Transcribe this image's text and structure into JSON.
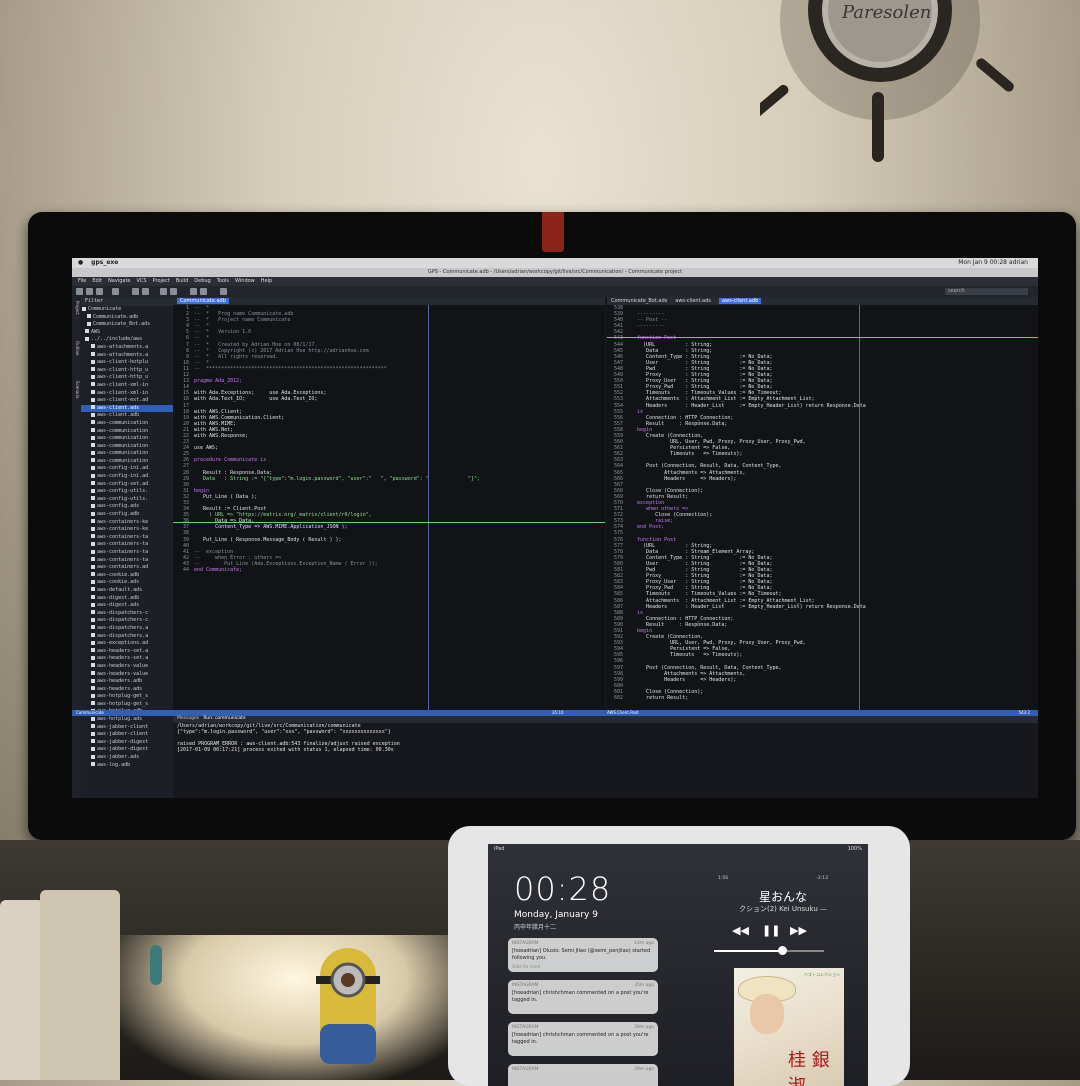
{
  "wall_clock": {
    "brand": "Paresolen"
  },
  "mac_menubar": {
    "app_name": "gps_exe",
    "status_right": "Mon Jan 9  00:28  adrian"
  },
  "window": {
    "title": "GPS - Communicate.adb - /Users/adrian/workcopy/git/live/src/Communication/ - Communicate project"
  },
  "menu": [
    "File",
    "Edit",
    "Navigate",
    "VCS",
    "Project",
    "Build",
    "Debug",
    "Tools",
    "Window",
    "Help"
  ],
  "search": {
    "placeholder": "search"
  },
  "side_tabs": [
    "Project",
    "Outline",
    "Scenario"
  ],
  "project_tree": {
    "filter_placeholder": "Filter",
    "items": [
      {
        "label": "Communicate",
        "sel": false
      },
      {
        "label": "Communicate.adb",
        "sel": false
      },
      {
        "label": "Communicate_Bot.ads",
        "sel": false
      },
      {
        "label": "AWS",
        "sel": false
      },
      {
        "label": "../../include/aws",
        "sel": false
      },
      {
        "label": "aws-attachments.a",
        "sel": false
      },
      {
        "label": "aws-attachments.a",
        "sel": false
      },
      {
        "label": "aws-client-hotplu",
        "sel": false
      },
      {
        "label": "aws-client-http_u",
        "sel": false
      },
      {
        "label": "aws-client-http_u",
        "sel": false
      },
      {
        "label": "aws-client-xml-in",
        "sel": false
      },
      {
        "label": "aws-client-xml-in",
        "sel": false
      },
      {
        "label": "aws-client-ext.ad",
        "sel": false
      },
      {
        "label": "aws-client.ads",
        "sel": true
      },
      {
        "label": "aws-client.adb",
        "sel": false
      },
      {
        "label": "aws-communication",
        "sel": false
      },
      {
        "label": "aws-communication",
        "sel": false
      },
      {
        "label": "aws-communication",
        "sel": false
      },
      {
        "label": "aws-communication",
        "sel": false
      },
      {
        "label": "aws-communication",
        "sel": false
      },
      {
        "label": "aws-communication",
        "sel": false
      },
      {
        "label": "aws-config-ini.ad",
        "sel": false
      },
      {
        "label": "aws-config-ini.ad",
        "sel": false
      },
      {
        "label": "aws-config-set.ad",
        "sel": false
      },
      {
        "label": "aws-config-utils.",
        "sel": false
      },
      {
        "label": "aws-config-utils.",
        "sel": false
      },
      {
        "label": "aws-config.ads",
        "sel": false
      },
      {
        "label": "aws-config.adb",
        "sel": false
      },
      {
        "label": "aws-containers-ke",
        "sel": false
      },
      {
        "label": "aws-containers-ke",
        "sel": false
      },
      {
        "label": "aws-containers-ta",
        "sel": false
      },
      {
        "label": "aws-containers-ta",
        "sel": false
      },
      {
        "label": "aws-containers-ta",
        "sel": false
      },
      {
        "label": "aws-containers-ta",
        "sel": false
      },
      {
        "label": "aws-containers.ad",
        "sel": false
      },
      {
        "label": "aws-cookie.adb",
        "sel": false
      },
      {
        "label": "aws-cookie.ads",
        "sel": false
      },
      {
        "label": "aws-default.ads",
        "sel": false
      },
      {
        "label": "aws-digest.adb",
        "sel": false
      },
      {
        "label": "aws-digest.ads",
        "sel": false
      },
      {
        "label": "aws-dispatchers-c",
        "sel": false
      },
      {
        "label": "aws-dispatchers-c",
        "sel": false
      },
      {
        "label": "aws-dispatchers.a",
        "sel": false
      },
      {
        "label": "aws-dispatchers.a",
        "sel": false
      },
      {
        "label": "aws-exceptions.ad",
        "sel": false
      },
      {
        "label": "aws-headers-set.a",
        "sel": false
      },
      {
        "label": "aws-headers-set.a",
        "sel": false
      },
      {
        "label": "aws-headers-value",
        "sel": false
      },
      {
        "label": "aws-headers-value",
        "sel": false
      },
      {
        "label": "aws-headers.adb",
        "sel": false
      },
      {
        "label": "aws-headers.ads",
        "sel": false
      },
      {
        "label": "aws-hotplug-get_s",
        "sel": false
      },
      {
        "label": "aws-hotplug-get_s",
        "sel": false
      },
      {
        "label": "aws-hotplug.adb",
        "sel": false
      },
      {
        "label": "aws-hotplug.ads",
        "sel": false
      },
      {
        "label": "aws-jabber-client",
        "sel": false
      },
      {
        "label": "aws-jabber-client",
        "sel": false
      },
      {
        "label": "aws-jabber-digest",
        "sel": false
      },
      {
        "label": "aws-jabber-digest",
        "sel": false
      },
      {
        "label": "aws-jabber.ads",
        "sel": false
      },
      {
        "label": "aws-log.adb",
        "sel": false
      }
    ]
  },
  "left_editor": {
    "tab": "Communicate.adb",
    "lines": [
      {
        "n": "1",
        "t": "--  *",
        "c": "cm"
      },
      {
        "n": "2",
        "t": "--  *   Prog name Communicate.adb",
        "c": "cm"
      },
      {
        "n": "3",
        "t": "--  *   Project name Communicate",
        "c": "cm"
      },
      {
        "n": "4",
        "t": "--  *",
        "c": "cm"
      },
      {
        "n": "5",
        "t": "--  *   Version 1.0",
        "c": "cm"
      },
      {
        "n": "6",
        "t": "--  *",
        "c": "cm"
      },
      {
        "n": "7",
        "t": "--  *   Created by Adrian Hoe on 08/1/17.",
        "c": "cm"
      },
      {
        "n": "8",
        "t": "--  *   Copyright (c) 2017 Adrian Hoe http://adrianhoe.com",
        "c": "cm"
      },
      {
        "n": "9",
        "t": "--  *   All rights reserved.",
        "c": "cm"
      },
      {
        "n": "10",
        "t": "--  *",
        "c": "cm"
      },
      {
        "n": "11",
        "t": "--  ************************************************************",
        "c": "cm"
      },
      {
        "n": "12",
        "t": "",
        "c": ""
      },
      {
        "n": "13",
        "t": "pragma Ada_2012;",
        "c": "kw"
      },
      {
        "n": "14",
        "t": "",
        "c": ""
      },
      {
        "n": "15",
        "t": "with Ada.Exceptions;     use Ada.Exceptions;",
        "c": ""
      },
      {
        "n": "16",
        "t": "with Ada.Text_IO;        use Ada.Text_IO;",
        "c": ""
      },
      {
        "n": "17",
        "t": "",
        "c": ""
      },
      {
        "n": "18",
        "t": "with AWS.Client;",
        "c": ""
      },
      {
        "n": "19",
        "t": "with AWS.Communication.Client;",
        "c": ""
      },
      {
        "n": "20",
        "t": "with AWS.MIME;",
        "c": ""
      },
      {
        "n": "21",
        "t": "with AWS.Net;",
        "c": ""
      },
      {
        "n": "22",
        "t": "with AWS.Response;",
        "c": ""
      },
      {
        "n": "23",
        "t": "",
        "c": ""
      },
      {
        "n": "24",
        "t": "use AWS;",
        "c": ""
      },
      {
        "n": "25",
        "t": "",
        "c": ""
      },
      {
        "n": "26",
        "t": "procedure Communicate is",
        "c": "kw"
      },
      {
        "n": "27",
        "t": "",
        "c": ""
      },
      {
        "n": "28",
        "t": "   Result : Response.Data;",
        "c": ""
      },
      {
        "n": "29",
        "t": "   Data   : String := \"{\"type\":\"m.login.password\", \"user\":\"   \", \"password\": \"             \"}\";",
        "c": "str"
      },
      {
        "n": "30",
        "t": "",
        "c": ""
      },
      {
        "n": "31",
        "t": "begin",
        "c": "kw"
      },
      {
        "n": "32",
        "t": "   Put_Line ( Data );",
        "c": ""
      },
      {
        "n": "33",
        "t": "",
        "c": ""
      },
      {
        "n": "34",
        "t": "   Result := Client.Post",
        "c": ""
      },
      {
        "n": "35",
        "t": "     ( URL => \"https://matrix.org/_matrix/client/r0/login\",",
        "c": "str"
      },
      {
        "n": "36",
        "t": "       Data => Data,",
        "c": ""
      },
      {
        "n": "37",
        "t": "       Content_Type => AWS.MIME.Application_JSON );",
        "c": ""
      },
      {
        "n": "38",
        "t": "",
        "c": ""
      },
      {
        "n": "39",
        "t": "   Put_Line ( Response.Message_Body ( Result ) );",
        "c": ""
      },
      {
        "n": "40",
        "t": "",
        "c": ""
      },
      {
        "n": "41",
        "t": "--  exception",
        "c": "cm"
      },
      {
        "n": "42",
        "t": "--     when Error : others =>",
        "c": "cm"
      },
      {
        "n": "43",
        "t": "--        Put_Line (Ada.Exceptions.Exception_Name ( Error ));",
        "c": "cm"
      },
      {
        "n": "44",
        "t": "end Communicate;",
        "c": "kw"
      }
    ]
  },
  "right_editor": {
    "tabs": [
      "Communicate_Bot.ads",
      "aws-client.ads",
      "aws-client.adb"
    ],
    "lines": [
      {
        "n": "538",
        "t": "",
        "c": ""
      },
      {
        "n": "539",
        "t": "   ---------",
        "c": "cm"
      },
      {
        "n": "540",
        "t": "   -- Post --",
        "c": "cm"
      },
      {
        "n": "541",
        "t": "   ---------",
        "c": "cm"
      },
      {
        "n": "542",
        "t": "",
        "c": ""
      },
      {
        "n": "543",
        "t": "   function Post",
        "c": "kw"
      },
      {
        "n": "544",
        "t": "     (URL          : String;",
        "c": ""
      },
      {
        "n": "545",
        "t": "      Data         : String;",
        "c": ""
      },
      {
        "n": "546",
        "t": "      Content_Type : String          := No_Data;",
        "c": ""
      },
      {
        "n": "547",
        "t": "      User         : String          := No_Data;",
        "c": ""
      },
      {
        "n": "548",
        "t": "      Pwd          : String          := No_Data;",
        "c": ""
      },
      {
        "n": "549",
        "t": "      Proxy        : String          := No_Data;",
        "c": ""
      },
      {
        "n": "550",
        "t": "      Proxy_User   : String          := No_Data;",
        "c": ""
      },
      {
        "n": "551",
        "t": "      Proxy_Pwd    : String          := No_Data;",
        "c": ""
      },
      {
        "n": "552",
        "t": "      Timeouts     : Timeouts_Values := No_Timeout;",
        "c": ""
      },
      {
        "n": "553",
        "t": "      Attachments  : Attachment_List := Empty_Attachment_List;",
        "c": ""
      },
      {
        "n": "554",
        "t": "      Headers      : Header_List     := Empty_Header_List) return Response.Data",
        "c": ""
      },
      {
        "n": "555",
        "t": "   is",
        "c": "kw"
      },
      {
        "n": "556",
        "t": "      Connection : HTTP_Connection;",
        "c": ""
      },
      {
        "n": "557",
        "t": "      Result     : Response.Data;",
        "c": ""
      },
      {
        "n": "558",
        "t": "   begin",
        "c": "kw"
      },
      {
        "n": "559",
        "t": "      Create (Connection,",
        "c": ""
      },
      {
        "n": "560",
        "t": "              URL, User, Pwd, Proxy, Proxy_User, Proxy_Pwd,",
        "c": ""
      },
      {
        "n": "561",
        "t": "              Persistent => False,",
        "c": ""
      },
      {
        "n": "562",
        "t": "              Timeouts   => Timeouts);",
        "c": ""
      },
      {
        "n": "563",
        "t": "",
        "c": ""
      },
      {
        "n": "564",
        "t": "      Post (Connection, Result, Data, Content_Type,",
        "c": ""
      },
      {
        "n": "565",
        "t": "            Attachments => Attachments,",
        "c": ""
      },
      {
        "n": "566",
        "t": "            Headers     => Headers);",
        "c": ""
      },
      {
        "n": "567",
        "t": "",
        "c": ""
      },
      {
        "n": "568",
        "t": "      Close (Connection);",
        "c": ""
      },
      {
        "n": "569",
        "t": "      return Result;",
        "c": ""
      },
      {
        "n": "570",
        "t": "   exception",
        "c": "kw"
      },
      {
        "n": "571",
        "t": "      when others =>",
        "c": "kw"
      },
      {
        "n": "572",
        "t": "         Close (Connection);",
        "c": ""
      },
      {
        "n": "573",
        "t": "         raise;",
        "c": "kw"
      },
      {
        "n": "574",
        "t": "   end Post;",
        "c": "kw"
      },
      {
        "n": "575",
        "t": "",
        "c": ""
      },
      {
        "n": "576",
        "t": "   function Post",
        "c": "kw"
      },
      {
        "n": "577",
        "t": "     (URL          : String;",
        "c": ""
      },
      {
        "n": "578",
        "t": "      Data         : Stream_Element_Array;",
        "c": ""
      },
      {
        "n": "579",
        "t": "      Content_Type : String          := No_Data;",
        "c": ""
      },
      {
        "n": "580",
        "t": "      User         : String          := No_Data;",
        "c": ""
      },
      {
        "n": "581",
        "t": "      Pwd          : String          := No_Data;",
        "c": ""
      },
      {
        "n": "582",
        "t": "      Proxy        : String          := No_Data;",
        "c": ""
      },
      {
        "n": "583",
        "t": "      Proxy_User   : String          := No_Data;",
        "c": ""
      },
      {
        "n": "584",
        "t": "      Proxy_Pwd    : String          := No_Data;",
        "c": ""
      },
      {
        "n": "585",
        "t": "      Timeouts     : Timeouts_Values := No_Timeout;",
        "c": ""
      },
      {
        "n": "586",
        "t": "      Attachments  : Attachment_List := Empty_Attachment_List;",
        "c": ""
      },
      {
        "n": "587",
        "t": "      Headers      : Header_List     := Empty_Header_List) return Response.Data",
        "c": ""
      },
      {
        "n": "588",
        "t": "   is",
        "c": "kw"
      },
      {
        "n": "589",
        "t": "      Connection : HTTP_Connection;",
        "c": ""
      },
      {
        "n": "590",
        "t": "      Result     : Response.Data;",
        "c": ""
      },
      {
        "n": "591",
        "t": "   begin",
        "c": "kw"
      },
      {
        "n": "592",
        "t": "      Create (Connection,",
        "c": ""
      },
      {
        "n": "593",
        "t": "              URL, User, Pwd, Proxy, Proxy_User, Proxy_Pwd,",
        "c": ""
      },
      {
        "n": "594",
        "t": "              Persistent => False,",
        "c": ""
      },
      {
        "n": "595",
        "t": "              Timeouts   => Timeouts);",
        "c": ""
      },
      {
        "n": "596",
        "t": "",
        "c": ""
      },
      {
        "n": "597",
        "t": "      Post (Connection, Result, Data, Content_Type,",
        "c": ""
      },
      {
        "n": "598",
        "t": "            Attachments => Attachments,",
        "c": ""
      },
      {
        "n": "599",
        "t": "            Headers     => Headers);",
        "c": ""
      },
      {
        "n": "600",
        "t": "",
        "c": ""
      },
      {
        "n": "601",
        "t": "      Close (Connection);",
        "c": ""
      },
      {
        "n": "602",
        "t": "      return Result;",
        "c": ""
      }
    ]
  },
  "status_bar": {
    "left": "Communicate",
    "pos_left": "35:10",
    "right": "AWS.Client.Post",
    "pos_right": "543:2"
  },
  "bottom_panel": {
    "tabs": [
      "Messages",
      "Run: communicate"
    ],
    "lines": [
      "/Users/adrian/workcopy/git/live/src/Communication/communicate",
      "{\"type\":\"m.login.password\", \"user\":\"xxx\", \"password\": \"xxxxxxxxxxxxxx\"}",
      "",
      "raised PROGRAM_ERROR : aws-client.adb:543 finalize/adjust raised exception",
      "[2017-01-09 00:17:21] process exited with status 1, elapsed time: 00.30s"
    ]
  },
  "ipad": {
    "device": "iPad",
    "battery": "100%",
    "time": "00:28",
    "date": "Monday, January 9",
    "date_lunar": "丙申年腊月十二",
    "notifications": [
      {
        "app": "INSTAGRAM",
        "ago": "14m ago",
        "body": "[hoeadrian] Olusio: Semi Jilao (@semi_penjilao) started following you.",
        "hint": "Slide for more"
      },
      {
        "app": "INSTAGRAM",
        "ago": "35m ago",
        "body": "[hoeadrian] chrishchman commented on a post you're tagged in.",
        "hint": ""
      },
      {
        "app": "INSTAGRAM",
        "ago": "38m ago",
        "body": "[hoeadrian] chrishchman commented on a post you're tagged in.",
        "hint": ""
      },
      {
        "app": "INSTAGRAM",
        "ago": "39m ago",
        "body": "",
        "hint": ""
      }
    ],
    "player": {
      "song": "星おんな",
      "artist": "クション(2)   Kei Unsuku —",
      "elapsed": "1:56",
      "remaining": "-2:13",
      "volume": 0.62,
      "cover_text": "桂 銀淑",
      "cover_text2": "",
      "cover_label": "ベストコレクション"
    }
  }
}
